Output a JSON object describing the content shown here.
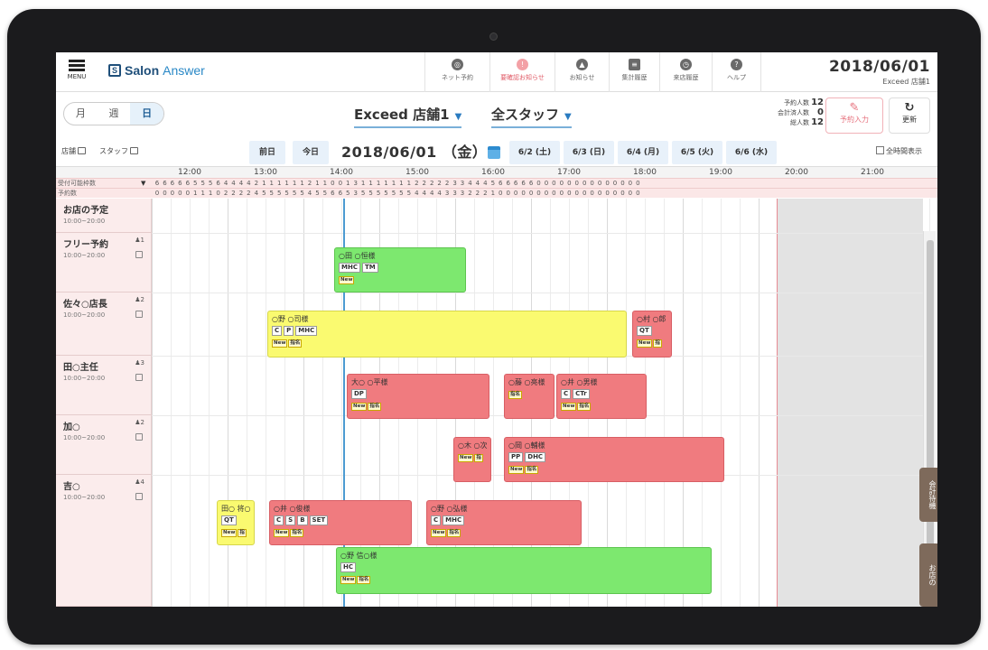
{
  "header": {
    "menu_label": "MENU",
    "logo_text": "Salon",
    "logo_text2": "Answer",
    "nav": [
      {
        "label": "ネット予約",
        "icon": "globe-icon"
      },
      {
        "label": "要確認お知らせ",
        "icon": "bell-alert-icon"
      },
      {
        "label": "お知らせ",
        "icon": "bell-icon"
      },
      {
        "label": "集計履歴",
        "icon": "ledger-icon"
      },
      {
        "label": "来店履歴",
        "icon": "clock-icon"
      },
      {
        "label": "ヘルプ",
        "icon": "help-icon"
      }
    ],
    "date": "2018/06/01",
    "store": "Exceed 店舗1"
  },
  "view_toggle": [
    "月",
    "週",
    "日"
  ],
  "store_select": "Exceed 店舗1",
  "staff_select": "全スタッフ",
  "counts": [
    {
      "label": "予約人数",
      "value": "12"
    },
    {
      "label": "会計済人数",
      "value": "0"
    },
    {
      "label": "総人数",
      "value": "12"
    }
  ],
  "reserve_button": "予約入力",
  "refresh_button": "更新",
  "toolbar": {
    "store_tab": "店舗",
    "staff_tab": "スタッフ",
    "prev": "前日",
    "today": "今日",
    "date": "2018/06/01 （金）",
    "days": [
      "6/2 (土)",
      "6/3 (日)",
      "6/4 (月)",
      "6/5 (火)",
      "6/6 (水)"
    ],
    "all_show": "全時間表示"
  },
  "hours": [
    "12:00",
    "13:00",
    "14:00",
    "15:00",
    "16:00",
    "17:00",
    "18:00",
    "19:00",
    "20:00",
    "21:00"
  ],
  "slots": {
    "available_label": "受付可能枠数",
    "reserved_label": "予約数",
    "available": [
      6,
      6,
      6,
      6,
      6,
      5,
      5,
      5,
      6,
      4,
      4,
      4,
      4,
      2,
      1,
      1,
      1,
      1,
      1,
      1,
      2,
      1,
      1,
      0,
      0,
      1,
      3,
      1,
      1,
      1,
      1,
      1,
      1,
      1,
      2,
      2,
      2,
      2,
      2,
      3,
      3,
      4,
      4,
      4,
      5,
      6,
      6,
      6,
      6,
      6,
      0,
      0,
      0,
      0,
      0,
      0,
      0,
      0,
      0,
      0,
      0,
      0,
      0,
      0
    ],
    "reserved": [
      0,
      0,
      0,
      0,
      0,
      1,
      1,
      1,
      0,
      2,
      2,
      2,
      2,
      4,
      5,
      5,
      5,
      5,
      5,
      5,
      4,
      5,
      5,
      6,
      6,
      5,
      3,
      5,
      5,
      5,
      5,
      5,
      5,
      5,
      4,
      4,
      4,
      4,
      3,
      3,
      3,
      2,
      2,
      2,
      1,
      0,
      0,
      0,
      0,
      0,
      0,
      0,
      0,
      0,
      0,
      0,
      0,
      0,
      0,
      0,
      0,
      0,
      0,
      0
    ]
  },
  "staff": [
    {
      "name": "お店の予定",
      "hours": "10:00~20:00",
      "count": ""
    },
    {
      "name": "フリー予約",
      "hours": "10:00~20:00",
      "count": "1"
    },
    {
      "name": "佐々○店長",
      "hours": "10:00~20:00",
      "count": "2"
    },
    {
      "name": "田○主任",
      "hours": "10:00~20:00",
      "count": "3"
    },
    {
      "name": "加○",
      "hours": "10:00~20:00",
      "count": "2"
    },
    {
      "name": "吉○",
      "hours": "10:00~20:00",
      "count": "4"
    }
  ],
  "appointments": [
    {
      "who": "○田 ○恒様",
      "menus": [
        "MHC",
        "TM"
      ],
      "badges": [
        "New"
      ],
      "color": "green"
    },
    {
      "who": "○野 ○司様",
      "menus": [
        "C",
        "P",
        "MHC"
      ],
      "badges": [
        "New",
        "指名"
      ],
      "color": "yellow"
    },
    {
      "who": "○村 ○郎",
      "menus": [
        "QT"
      ],
      "badges": [
        "New",
        "指"
      ],
      "color": "red"
    },
    {
      "who": "大○ ○平様",
      "menus": [
        "DP"
      ],
      "badges": [
        "New",
        "指名"
      ],
      "color": "red"
    },
    {
      "who": "○藤 ○亮様",
      "menus": [],
      "badges": [
        "指名"
      ],
      "color": "red"
    },
    {
      "who": "○井 ○男様",
      "menus": [
        "C",
        "CTr"
      ],
      "badges": [
        "New",
        "指名"
      ],
      "color": "red"
    },
    {
      "who": "○木 ○次",
      "menus": [],
      "badges": [
        "New",
        "指"
      ],
      "color": "red"
    },
    {
      "who": "○岡 ○輔様",
      "menus": [
        "PP",
        "DHC"
      ],
      "badges": [
        "New",
        "指名"
      ],
      "color": "red"
    },
    {
      "who": "田○ 将○",
      "menus": [
        "QT"
      ],
      "badges": [
        "New",
        "指"
      ],
      "color": "yellow"
    },
    {
      "who": "○井 ○俊様",
      "menus": [
        "C",
        "S",
        "B",
        "SET"
      ],
      "badges": [
        "New",
        "指名"
      ],
      "color": "red"
    },
    {
      "who": "○野 ○弘様",
      "menus": [
        "C",
        "MHC"
      ],
      "badges": [
        "New",
        "指名"
      ],
      "color": "red"
    },
    {
      "who": "○野 信○様",
      "menus": [
        "HC"
      ],
      "badges": [
        "New",
        "指名"
      ],
      "color": "green"
    }
  ],
  "side_tabs": [
    "会計待機",
    "お店の"
  ]
}
